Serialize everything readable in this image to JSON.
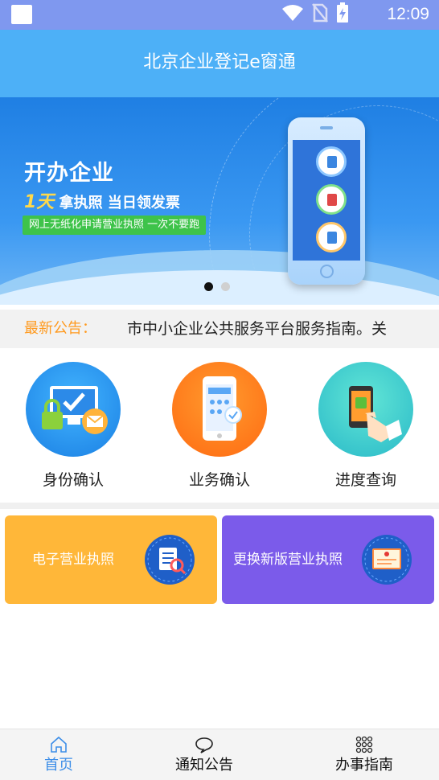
{
  "status_bar": {
    "time": "12:09",
    "icons": [
      "notification-square-icon",
      "wifi-icon",
      "no-sim-icon",
      "battery-charging-icon"
    ]
  },
  "header": {
    "title": "北京企业登记e窗通"
  },
  "banner": {
    "headline": "开办企业",
    "sub_highlight": "1天",
    "sub_text": "拿执照  当日领发票",
    "green_badge": "网上无纸化申请营业执照  一次不要跑",
    "dots_total": 2,
    "dots_active_index": 0
  },
  "notice": {
    "label": "最新公告：",
    "text": "市中小企业公共服务平台服务指南。关"
  },
  "actions": [
    {
      "label": "身份确认",
      "icon": "identity-lock-mail-icon"
    },
    {
      "label": "业务确认",
      "icon": "phone-app-icon"
    },
    {
      "label": "进度查询",
      "icon": "hand-phone-icon"
    }
  ],
  "cards": [
    {
      "label": "电子营业执照",
      "icon": "license-magnifier-icon",
      "color": "#ffb739"
    },
    {
      "label": "更换新版营业执照",
      "icon": "certificate-icon",
      "color": "#7b5bea"
    }
  ],
  "bottom_nav": [
    {
      "label": "首页",
      "icon": "home-icon",
      "active": true
    },
    {
      "label": "通知公告",
      "icon": "chat-bubble-icon",
      "active": false
    },
    {
      "label": "办事指南",
      "icon": "grid-dots-icon",
      "active": false
    }
  ],
  "colors": {
    "status_bar": "#7f98ef",
    "header": "#4db0f7",
    "notice_label": "#ff9a1f",
    "nav_active": "#3d8ee8"
  }
}
